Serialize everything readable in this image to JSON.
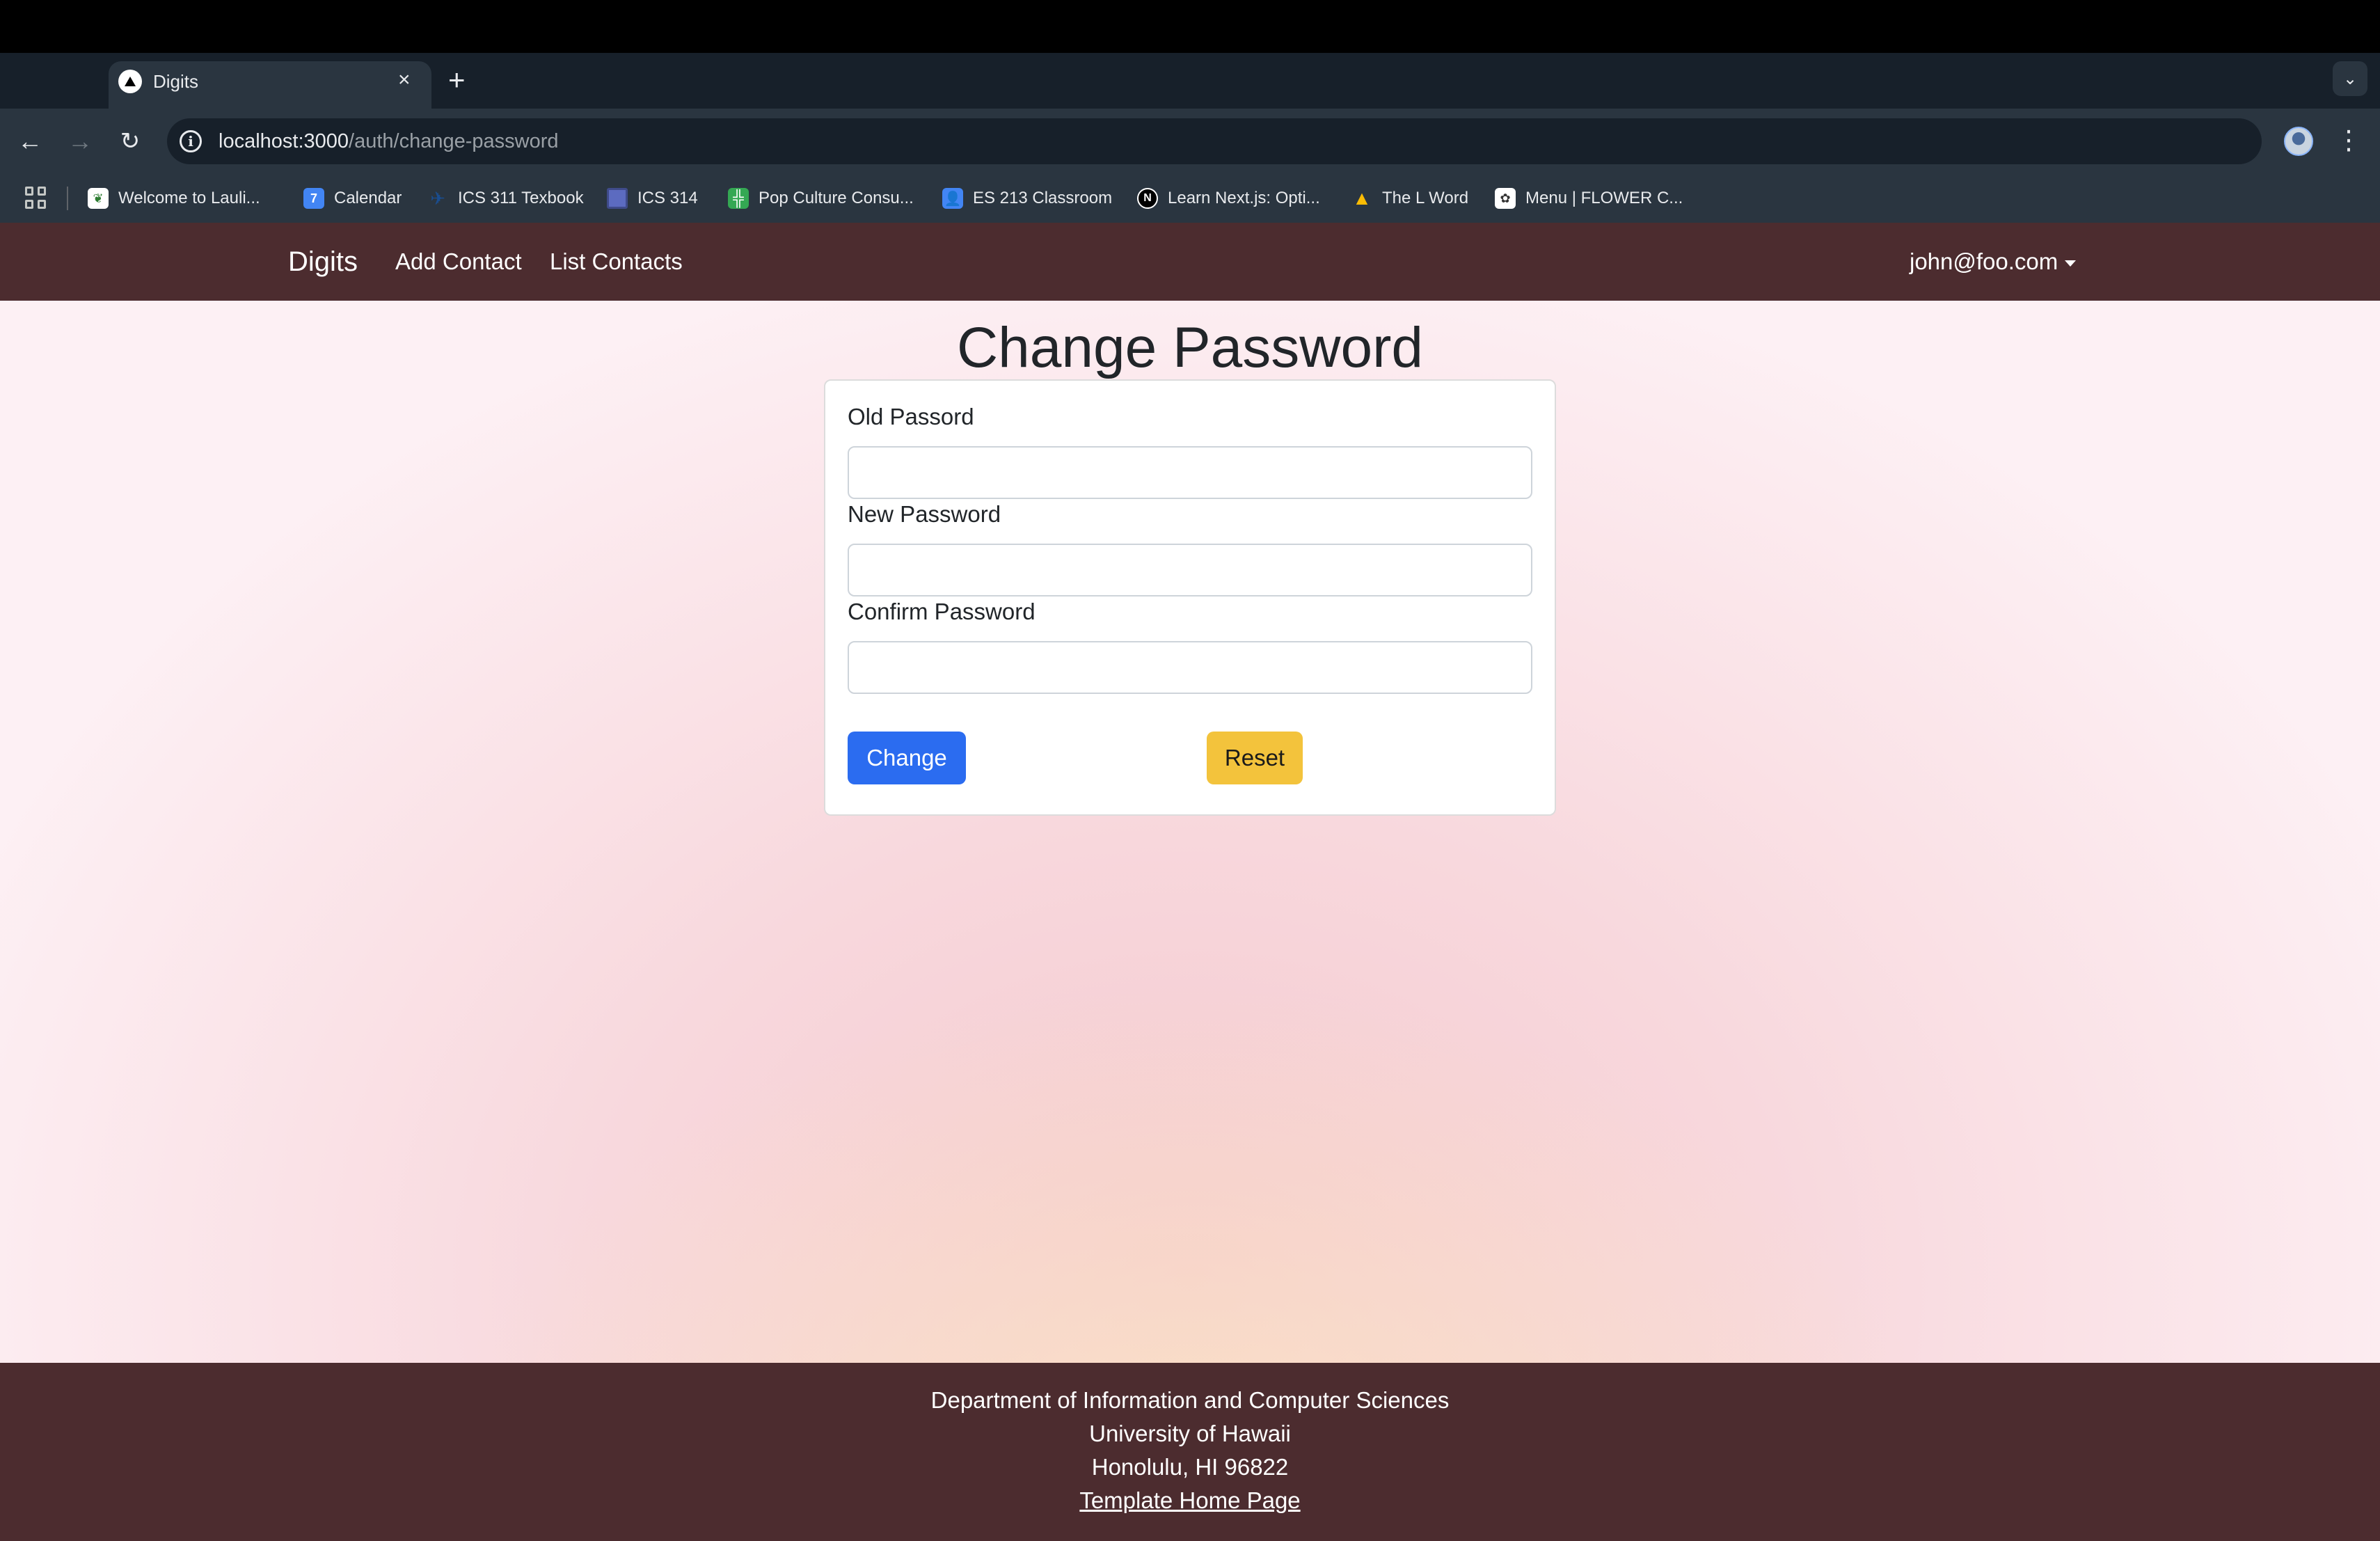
{
  "browser": {
    "tab_title": "Digits",
    "tab_close": "×",
    "new_tab": "+",
    "url_host": "localhost:3000",
    "url_path": "/auth/change-password",
    "bookmarks": [
      {
        "label": "Welcome to Lauli...",
        "icon": "leaf-favicon",
        "color": "#2e7d32"
      },
      {
        "label": "Calendar",
        "icon": "calendar-favicon",
        "color": "#4285f4"
      },
      {
        "label": "ICS 311 Texbook",
        "icon": "bird-favicon",
        "color": "#1a4d8f"
      },
      {
        "label": "ICS 314",
        "icon": "square-favicon",
        "color": "#5c6bc0"
      },
      {
        "label": "Pop Culture Consu...",
        "icon": "sheets-favicon",
        "color": "#34a853"
      },
      {
        "label": "ES 213 Classroom",
        "icon": "classroom-favicon",
        "color": "#4285f4"
      },
      {
        "label": "Learn Next.js: Opti...",
        "icon": "nextjs-favicon",
        "color": "#000000"
      },
      {
        "label": "The L Word",
        "icon": "drive-favicon",
        "color": "#fbbc04"
      },
      {
        "label": "Menu | FLOWER C...",
        "icon": "flower-favicon",
        "color": "#ffffff"
      }
    ]
  },
  "navbar": {
    "brand": "Digits",
    "links": [
      "Add Contact",
      "List Contacts"
    ],
    "user": "john@foo.com"
  },
  "page": {
    "title": "Change Password"
  },
  "form": {
    "old_password_label": "Old Passord",
    "new_password_label": "New Password",
    "confirm_password_label": "Confirm Password",
    "change_button": "Change",
    "reset_button": "Reset"
  },
  "footer": {
    "line1": "Department of Information and Computer Sciences",
    "line2": "University of Hawaii",
    "line3": "Honolulu, HI 96822",
    "link": "Template Home Page"
  },
  "colors": {
    "navbar_bg": "#4c2c2f",
    "primary_button": "#2b6cf0",
    "warning_button": "#f3c33c"
  }
}
